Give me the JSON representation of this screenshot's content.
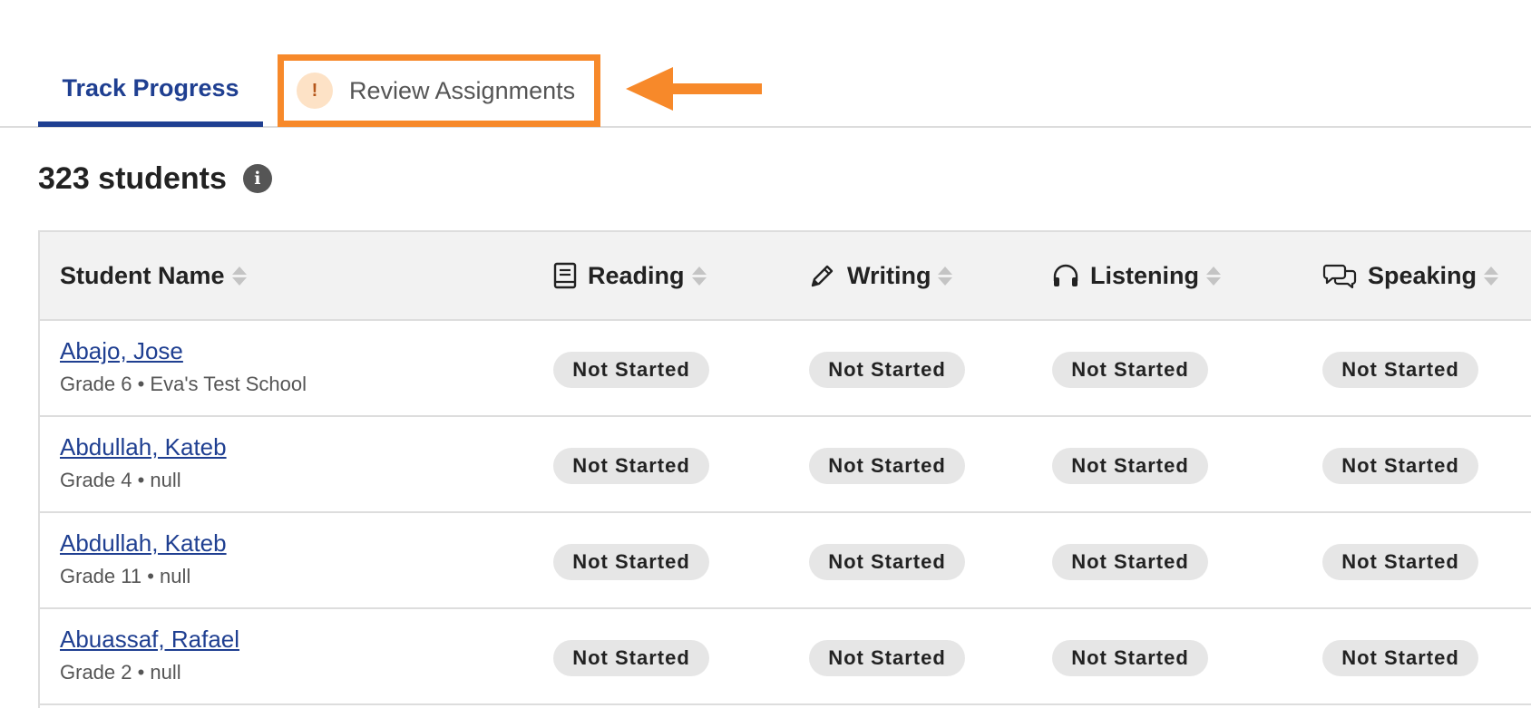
{
  "tabs": {
    "track_progress": "Track Progress",
    "review_assignments": "Review Assignments",
    "review_alert_glyph": "!"
  },
  "summary": {
    "student_count_label": "323 students",
    "info_glyph": "i"
  },
  "table": {
    "headers": {
      "student_name": "Student Name",
      "reading": "Reading",
      "writing": "Writing",
      "listening": "Listening",
      "speaking": "Speaking"
    },
    "rows": [
      {
        "name": "Abajo, Jose",
        "details": "Grade 6 • Eva's Test School",
        "reading": "Not Started",
        "writing": "Not Started",
        "listening": "Not Started",
        "speaking": "Not Started"
      },
      {
        "name": "Abdullah, Kateb",
        "details": "Grade 4 • null",
        "reading": "Not Started",
        "writing": "Not Started",
        "listening": "Not Started",
        "speaking": "Not Started"
      },
      {
        "name": "Abdullah, Kateb",
        "details": "Grade 11 • null",
        "reading": "Not Started",
        "writing": "Not Started",
        "listening": "Not Started",
        "speaking": "Not Started"
      },
      {
        "name": "Abuassaf, Rafael",
        "details": "Grade 2 • null",
        "reading": "Not Started",
        "writing": "Not Started",
        "listening": "Not Started",
        "speaking": "Not Started"
      }
    ]
  },
  "icons": {
    "alert": "exclamation-icon",
    "info": "info-icon",
    "reading": "book-icon",
    "writing": "pencil-icon",
    "listening": "headphones-icon",
    "speaking": "speech-bubbles-icon",
    "sort": "sort-icon",
    "annotation": "arrow-left-icon"
  },
  "colors": {
    "brand_blue": "#1f3f91",
    "highlight_orange": "#f7892a",
    "pill_gray": "#e6e6e6",
    "header_bg": "#f2f2f2"
  }
}
